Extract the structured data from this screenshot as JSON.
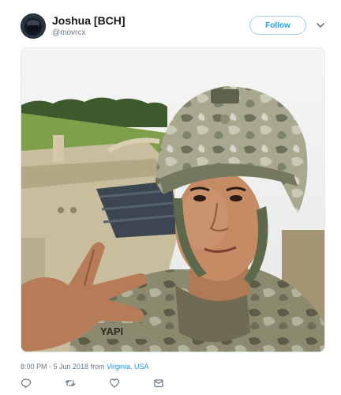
{
  "tweet": {
    "user": {
      "name": "Joshua [BCH]",
      "handle": "@movrcx"
    },
    "follow_label": "Follow",
    "timestamp": "8:00 PM - 5 Jun 2018",
    "from_label": "from",
    "location": "Virginia, USA",
    "actions": [
      "reply-icon",
      "retweet-icon",
      "like-icon",
      "message-icon"
    ],
    "media": {
      "description_icon": "photo"
    }
  },
  "colors": {
    "accent": "#1da1f2",
    "link": "#1b95e0",
    "muted": "#657786",
    "border": "#e1e8ed"
  }
}
